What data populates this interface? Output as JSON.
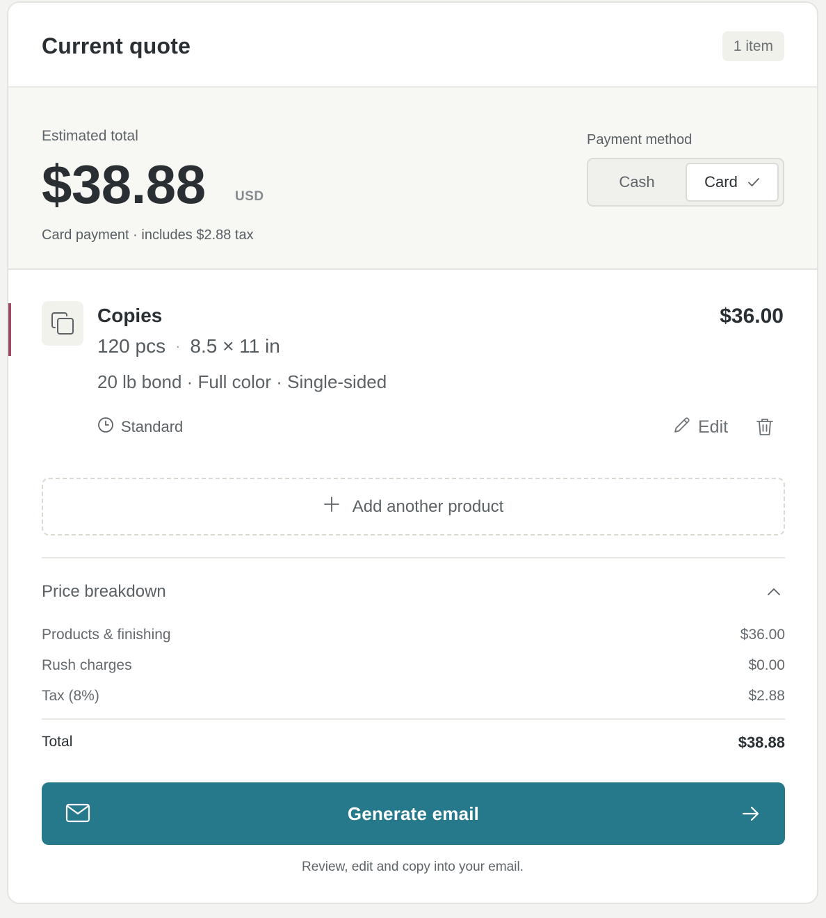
{
  "header": {
    "title": "Current quote",
    "item_count": "1 item"
  },
  "summary": {
    "estimated_label": "Estimated total",
    "amount": "$38.88",
    "currency": "USD",
    "note": "Card payment · includes $2.88 tax",
    "payment_method": {
      "label": "Payment method",
      "options": [
        "Cash",
        "Card"
      ],
      "selected": "Card"
    }
  },
  "product": {
    "name": "Copies",
    "price": "$36.00",
    "quantity": "120 pcs",
    "meta_separator": "·",
    "size": "8.5 × 11 in",
    "spec": "20 lb bond · Full color · Single-sided",
    "turnaround": "Standard",
    "edit_label": "Edit",
    "icon": "copies-icon",
    "accent_color": "#9b4a62"
  },
  "add_product_label": "Add another product",
  "breakdown": {
    "title": "Price breakdown",
    "expanded": true,
    "rows": [
      {
        "label": "Products & finishing",
        "value": "$36.00"
      },
      {
        "label": "Rush charges",
        "value": "$0.00"
      },
      {
        "label": "Tax (8%)",
        "value": "$2.88"
      }
    ],
    "total_label": "Total",
    "total_value": "$38.88"
  },
  "cta": {
    "label": "Generate email",
    "note": "Review, edit and copy into your email.",
    "color": "#26788b"
  }
}
